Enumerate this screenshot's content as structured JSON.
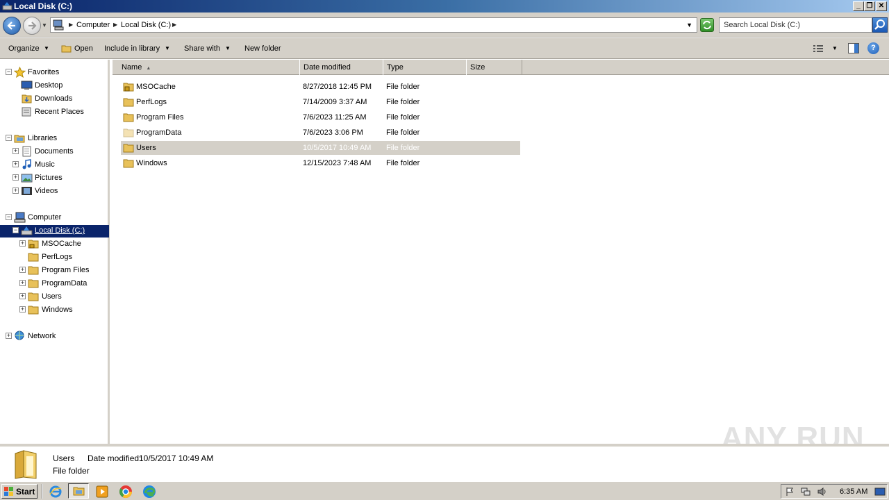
{
  "window": {
    "title": "Local Disk (C:)",
    "min_label": "_",
    "restore_label": "❐",
    "close_label": "✕"
  },
  "address": {
    "crumbs": [
      "Computer",
      "Local Disk (C:)"
    ],
    "search_placeholder": "Search Local Disk (C:)"
  },
  "toolbar": {
    "organize": "Organize",
    "open": "Open",
    "include_in_library": "Include in library",
    "share_with": "Share with",
    "new_folder": "New folder"
  },
  "nav": {
    "favorites": "Favorites",
    "desktop": "Desktop",
    "downloads": "Downloads",
    "recent_places": "Recent Places",
    "libraries": "Libraries",
    "documents": "Documents",
    "music": "Music",
    "pictures": "Pictures",
    "videos": "Videos",
    "computer": "Computer",
    "local_disk": "Local Disk (C:)",
    "subfolders": [
      "MSOCache",
      "PerfLogs",
      "Program Files",
      "ProgramData",
      "Users",
      "Windows"
    ],
    "network": "Network"
  },
  "columns": {
    "name": "Name",
    "date_modified": "Date modified",
    "type": "Type",
    "size": "Size"
  },
  "files": [
    {
      "name": "MSOCache",
      "date": "8/27/2018 12:45 PM",
      "type": "File folder",
      "locked": true
    },
    {
      "name": "PerfLogs",
      "date": "7/14/2009 3:37 AM",
      "type": "File folder"
    },
    {
      "name": "Program Files",
      "date": "7/6/2023 11:25 AM",
      "type": "File folder"
    },
    {
      "name": "ProgramData",
      "date": "7/6/2023 3:06 PM",
      "type": "File folder",
      "faded": true
    },
    {
      "name": "Users",
      "date": "10/5/2017 10:49 AM",
      "type": "File folder",
      "selected": true
    },
    {
      "name": "Windows",
      "date": "12/15/2023 7:48 AM",
      "type": "File folder"
    }
  ],
  "details": {
    "name": "Users",
    "date_label": "Date modified:",
    "date_value": "10/5/2017 10:49 AM",
    "type": "File folder"
  },
  "taskbar": {
    "start": "Start",
    "clock": "6:35 AM"
  },
  "watermark": "ANY RUN",
  "colors": {
    "selection": "#0a246a",
    "chrome": "#d4d0c8",
    "folder": "#e8c15a"
  }
}
